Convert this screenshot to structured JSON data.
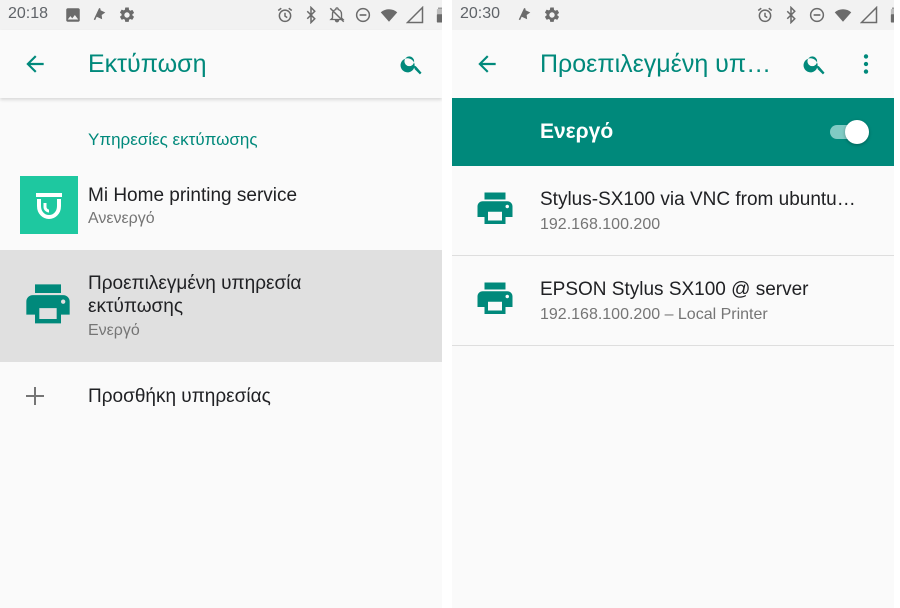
{
  "colors": {
    "accent": "#00897b",
    "mi_logo_bg": "#1ec8a0",
    "selected_row_bg": "#e0e0e0",
    "status_bar_bg": "#f2f2f2"
  },
  "left_screen": {
    "status_bar": {
      "time": "20:18",
      "left_icons": [
        "image-icon",
        "flag-icon",
        "gear-icon"
      ],
      "right_icons": [
        "alarm-icon",
        "bluetooth-icon",
        "notifications-off-icon",
        "do-not-disturb-icon",
        "wifi-icon",
        "no-signal-icon",
        "battery-icon"
      ]
    },
    "app_bar": {
      "title": "Εκτύπωση",
      "back_icon": "arrow-back-icon",
      "search_icon": "search-icon"
    },
    "section_header": "Υπηρεσίες εκτύπωσης",
    "services": [
      {
        "icon": "mi-home-logo",
        "title": "Mi Home printing service",
        "subtitle": "Ανενεργό",
        "selected": false
      },
      {
        "icon": "printer-icon",
        "title_line1": "Προεπιλεγμένη υπηρεσία",
        "title_line2": "εκτύπωσης",
        "subtitle": "Ενεργό",
        "selected": true
      }
    ],
    "add_service": {
      "icon": "plus-icon",
      "label": "Προσθήκη υπηρεσίας"
    }
  },
  "right_screen": {
    "status_bar": {
      "time": "20:30",
      "left_icons": [
        "flag-icon",
        "gear-icon"
      ],
      "right_icons": [
        "alarm-icon",
        "bluetooth-icon",
        "do-not-disturb-icon",
        "wifi-icon",
        "no-signal-icon",
        "battery-icon"
      ]
    },
    "app_bar": {
      "title": "Προεπιλεγμένη υπ…",
      "back_icon": "arrow-back-icon",
      "search_icon": "search-icon",
      "overflow_icon": "more-vert-icon"
    },
    "master_switch": {
      "label": "Ενεργό",
      "on": true
    },
    "printers": [
      {
        "icon": "printer-icon",
        "name": "Stylus-SX100 via VNC from ubuntu…",
        "detail": "192.168.100.200"
      },
      {
        "icon": "printer-icon",
        "name": "EPSON Stylus SX100 @ server",
        "detail": "192.168.100.200 – Local Printer"
      }
    ]
  }
}
